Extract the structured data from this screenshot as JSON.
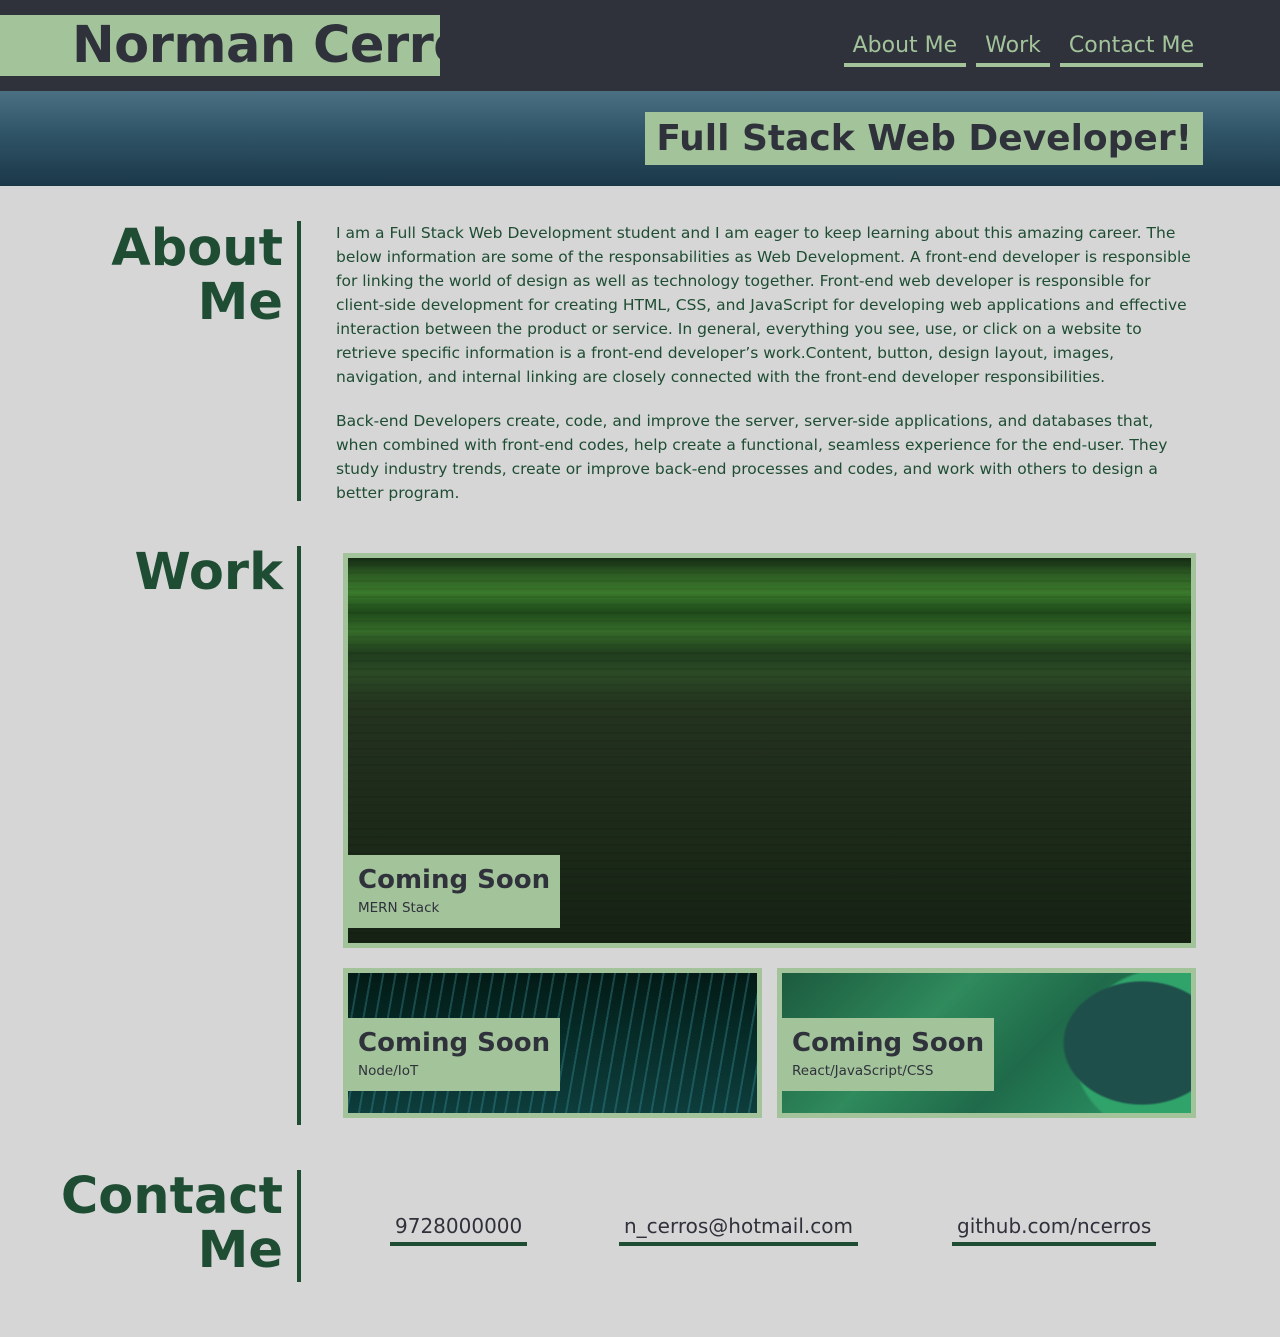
{
  "header": {
    "brand": "Norman Cerros",
    "nav": [
      "About Me",
      "Work",
      "Contact Me"
    ]
  },
  "hero": {
    "tagline": "Full Stack Web Developer!"
  },
  "about": {
    "title_line1": "About",
    "title_line2": "Me",
    "paragraphs": [
      "I am a Full Stack Web Development student and I am eager to keep learning about this amazing career. The below information are some of the responsabilities as Web Development. A front-end developer is responsible for linking the world of design as well as technology together. Front-end web developer is responsible for client-side development for creating HTML, CSS, and JavaScript for developing web applications and effective interaction between the product or service. In general, everything you see, use, or click on a website to retrieve specific information is a front-end developer’s work.Content, button, design layout, images, navigation, and internal linking are closely connected with the front-end developer responsibilities.",
      "Back-end Developers create, code, and improve the server, server-side applications, and databases that, when combined with front-end codes, help create a functional, seamless experience for the end-user. They study industry trends, create or improve back-end processes and codes, and work with others to design a better program."
    ]
  },
  "work": {
    "title": "Work",
    "projects": [
      {
        "title": "Coming Soon",
        "stack": "MERN Stack"
      },
      {
        "title": "Coming Soon",
        "stack": "Node/IoT"
      },
      {
        "title": "Coming Soon",
        "stack": "React/JavaScript/CSS"
      }
    ]
  },
  "contact": {
    "title_line1": "Contact",
    "title_line2": "Me",
    "phone": "9728000000",
    "email": "n_cerros@hotmail.com",
    "github": "github.com/ncerros"
  },
  "colors": {
    "header_bg": "#2f323b",
    "accent_green": "#a3c39b",
    "dark_green": "#1e4d33",
    "page_bg": "#d6d6d6"
  }
}
